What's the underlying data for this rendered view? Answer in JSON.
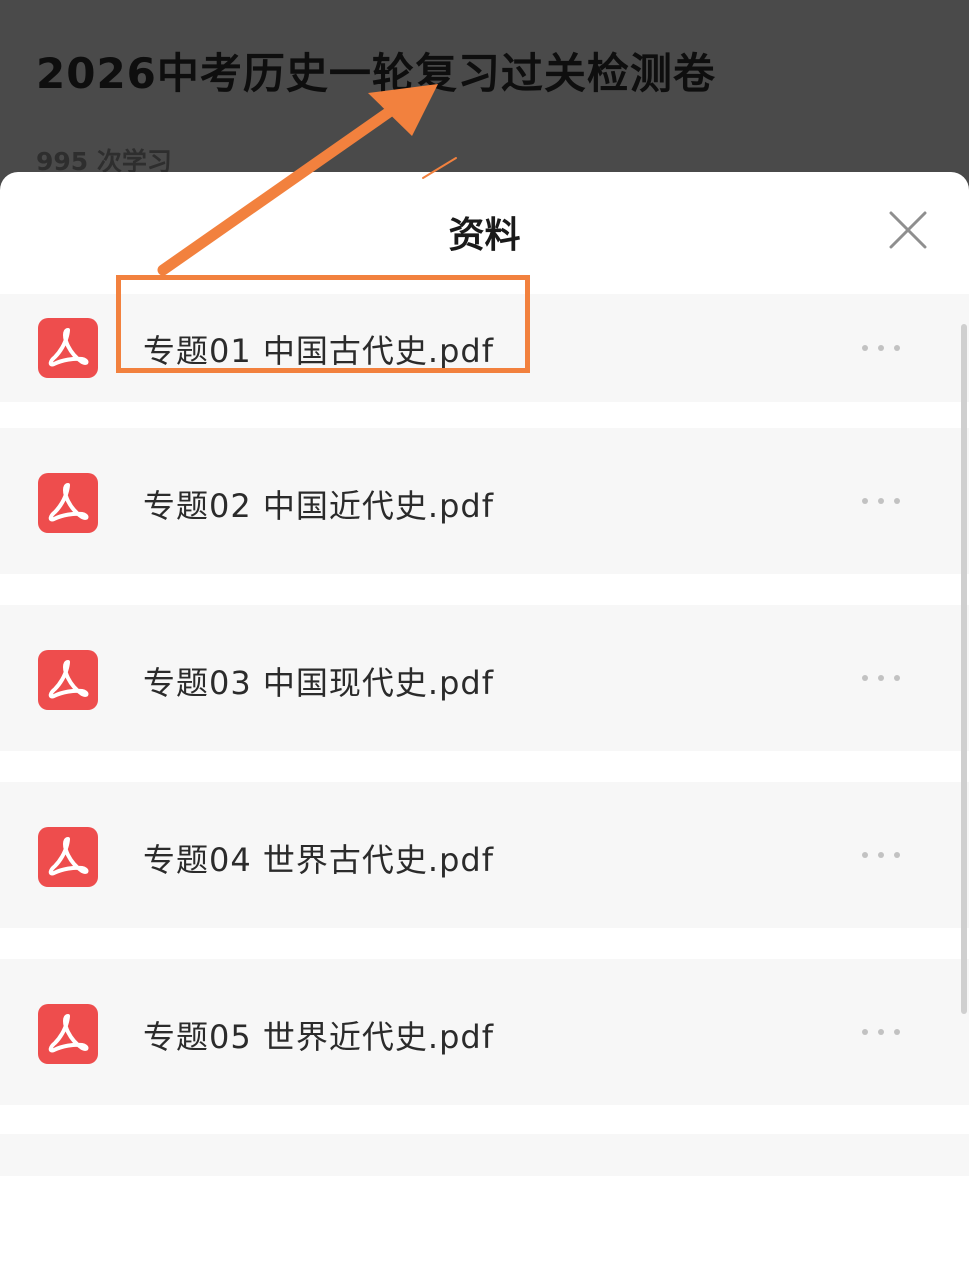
{
  "course": {
    "title": "2026中考历史一轮复习过关检测卷",
    "study_count": "995 次学习"
  },
  "sheet": {
    "title": "资料",
    "close_icon": "close-icon",
    "files": [
      {
        "name": "专题01 中国古代史.pdf",
        "icon": "pdf-icon",
        "highlighted": true
      },
      {
        "name": "专题02 中国近代史.pdf",
        "icon": "pdf-icon",
        "highlighted": false
      },
      {
        "name": "专题03 中国现代史.pdf",
        "icon": "pdf-icon",
        "highlighted": false
      },
      {
        "name": "专题04 世界古代史.pdf",
        "icon": "pdf-icon",
        "highlighted": false
      },
      {
        "name": "专题05 世界近代史.pdf",
        "icon": "pdf-icon",
        "highlighted": false
      }
    ]
  },
  "colors": {
    "pdf_icon": "#ee4d4d",
    "annotation": "#f2813e",
    "overlay": "#4a4a4a"
  }
}
